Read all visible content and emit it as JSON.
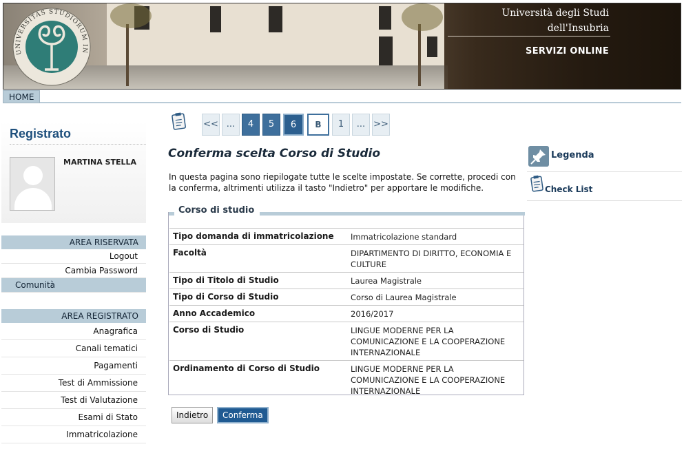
{
  "header": {
    "university_line1": "Università degli Studi",
    "university_line2": "dell'Insubria",
    "services": "SERVIZI ONLINE",
    "logo_text": "UNIVERSITAS STUDIORUM INSUBRIAE"
  },
  "menubar": {
    "home": "HOME"
  },
  "sidebar": {
    "title": "Registrato",
    "user_name": "MARTINA STELLA",
    "area_riservata": {
      "heading": "AREA RISERVATA",
      "items": [
        "Logout",
        "Cambia Password",
        "Comunità"
      ]
    },
    "area_registrato": {
      "heading": "AREA REGISTRATO",
      "items": [
        "Anagrafica",
        "Canali tematici",
        "Pagamenti",
        "Test di Ammissione",
        "Test di Valutazione",
        "Esami di Stato",
        "Immatricolazione"
      ]
    }
  },
  "pager": {
    "items": [
      "<<",
      "...",
      "4",
      "5",
      "6",
      "B",
      "1",
      "...",
      ">>"
    ]
  },
  "main": {
    "title": "Conferma scelta Corso di Studio",
    "intro": "In questa pagina sono riepilogate tutte le scelte impostate. Se corrette, procedi con la conferma, altrimenti utilizza il tasto \"Indietro\" per apportare le modifiche.",
    "section_title": "Corso di studio",
    "rows": [
      {
        "label": "Tipo domanda di immatricolazione",
        "value": "Immatricolazione standard"
      },
      {
        "label": "Facoltà",
        "value": "DIPARTIMENTO DI DIRITTO, ECONOMIA E CULTURE"
      },
      {
        "label": "Tipo di Titolo di Studio",
        "value": "Laurea Magistrale"
      },
      {
        "label": "Tipo di Corso di Studio",
        "value": "Corso di Laurea Magistrale"
      },
      {
        "label": "Anno Accademico",
        "value": "2016/2017"
      },
      {
        "label": "Corso di Studio",
        "value": "LINGUE MODERNE PER LA COMUNICAZIONE E LA COOPERAZIONE INTERNAZIONALE"
      },
      {
        "label": "Ordinamento di Corso di Studio",
        "value": "LINGUE MODERNE PER LA COMUNICAZIONE E LA COOPERAZIONE INTERNAZIONALE"
      }
    ],
    "back_button": "Indietro",
    "confirm_button": "Conferma"
  },
  "right_panel": {
    "legenda": "Legenda",
    "checklist": "Check List"
  }
}
